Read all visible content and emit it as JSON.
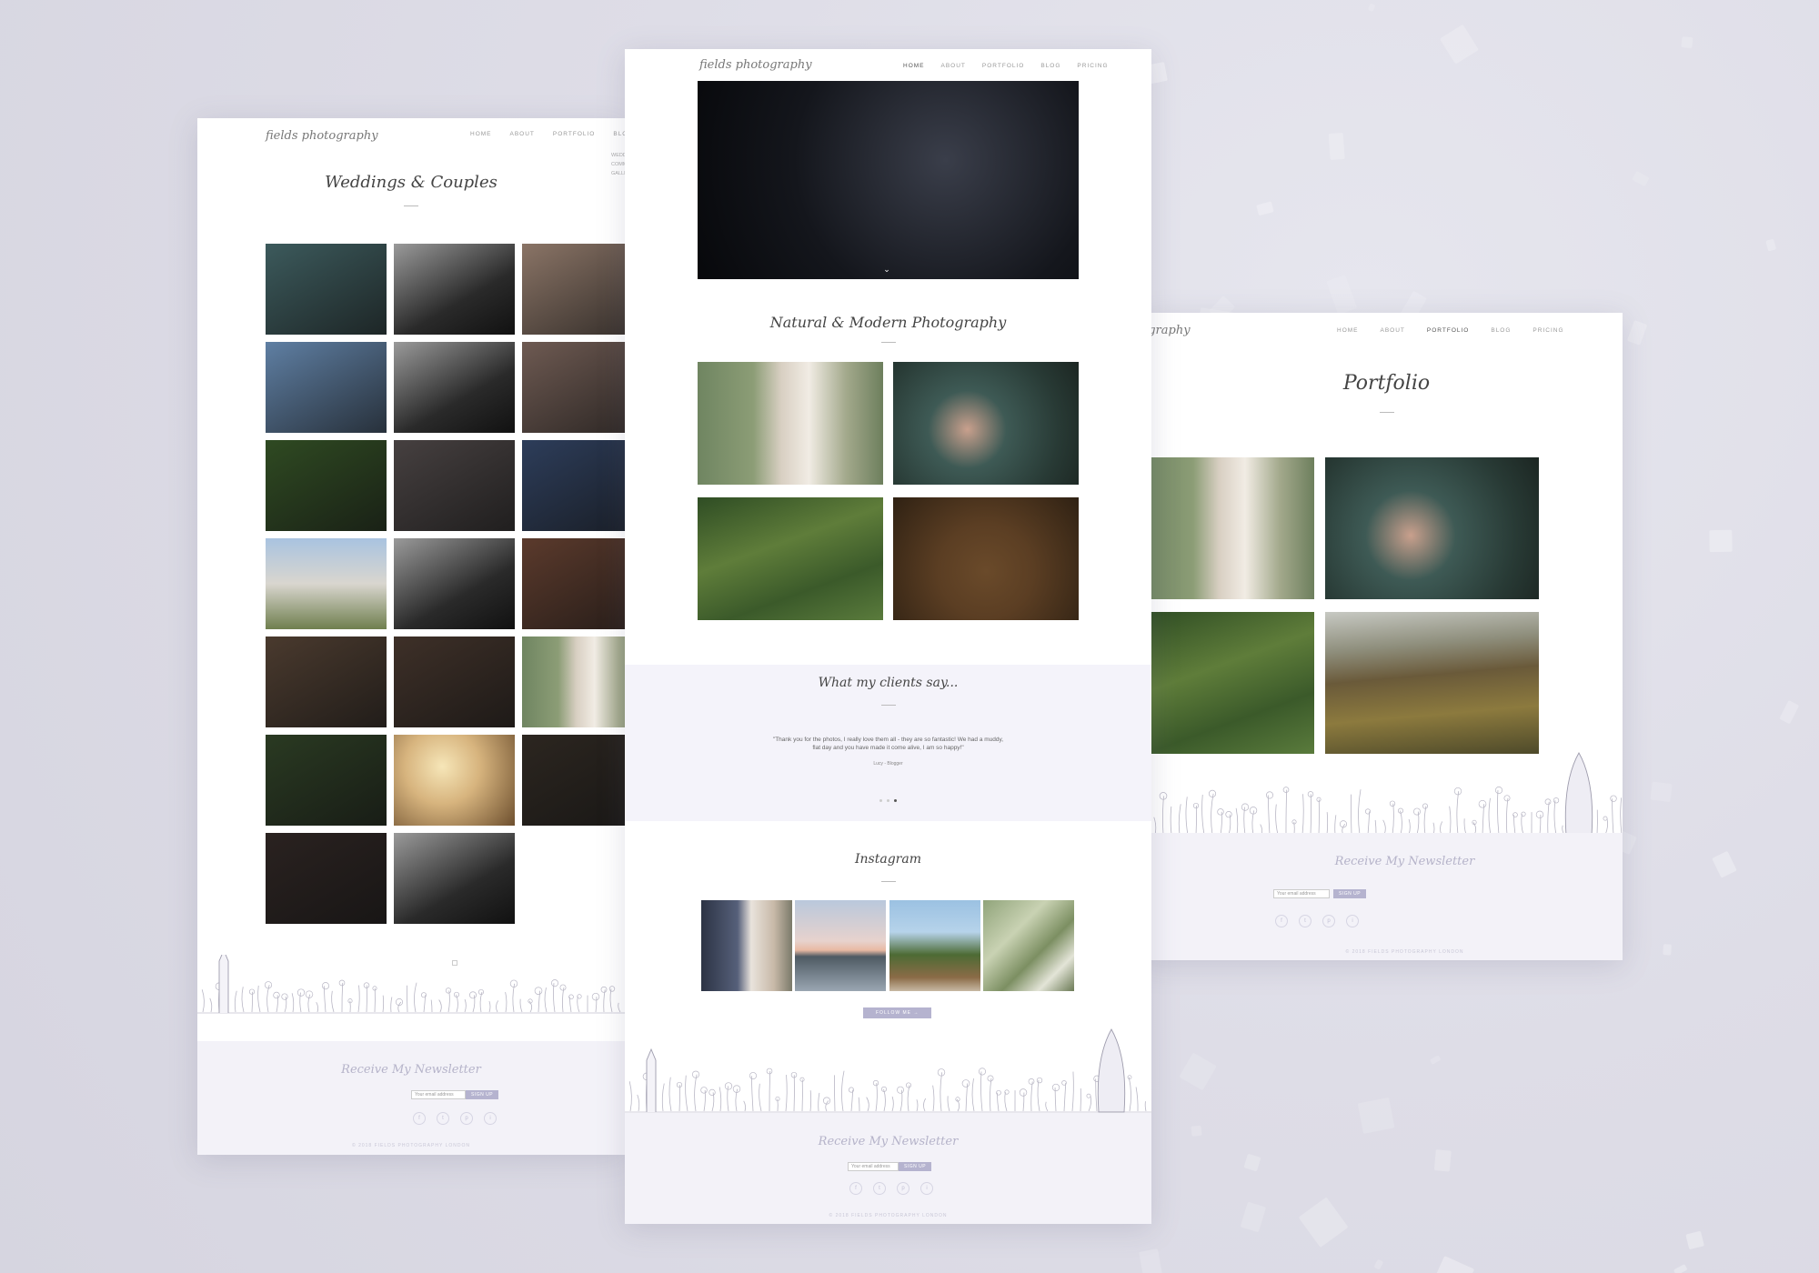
{
  "brand": {
    "logo_text": "fields photography"
  },
  "nav": {
    "items": [
      "HOME",
      "ABOUT",
      "PORTFOLIO",
      "BLOG",
      "PRICING"
    ]
  },
  "left_page": {
    "title": "Weddings & Couples",
    "active_nav": "PORTFOLIO",
    "dropdown_items": [
      "WEDDINGS",
      "COMMERCIAL",
      "GALLERY"
    ]
  },
  "center_page": {
    "active_nav": "HOME",
    "section_title": "Natural & Modern Photography",
    "testimonials": {
      "title": "What my clients say...",
      "quote": "\"Thank you for the photos, I really love them all - they are so fantastic! We had a muddy, flat day and you have made it come alive, I am so happy!\"",
      "author": "Lucy - Blogger",
      "slide_count": 3,
      "active_slide": 3
    },
    "instagram": {
      "title": "Instagram",
      "button": "FOLLOW ME"
    }
  },
  "right_page": {
    "active_nav": "PORTFOLIO",
    "title": "Portfolio"
  },
  "newsletter": {
    "title": "Receive My Newsletter",
    "placeholder": "Your email address",
    "button": "SIGN UP"
  },
  "socials": [
    "f",
    "t",
    "p",
    "i"
  ],
  "copyright": "© 2018 FIELDS PHOTOGRAPHY LONDON",
  "colors": {
    "accent": "#b5b3cf",
    "footer_bg": "#f3f2f8",
    "background": "#dddde6"
  }
}
